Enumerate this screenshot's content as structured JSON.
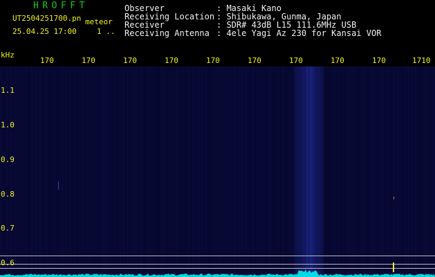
{
  "header": {
    "app_title": "HROFFT",
    "filename": "UT2504251700.pn",
    "mode": "meteor",
    "datetime": "25.04.25 17:00",
    "count": "1 .."
  },
  "station": {
    "fields": [
      {
        "label": "Observer",
        "value": ": Masaki Kano"
      },
      {
        "label": "Receiving Location",
        "value": ": Shibukawa, Gunma, Japan"
      },
      {
        "label": "Receiver",
        "value": ": SDR# 43dB L15 111.6MHz USB"
      },
      {
        "label": "Receiving Antenna",
        "value": ": 4ele Yagi Az 230 for Kansai VOR"
      }
    ]
  },
  "axes": {
    "y_unit": "kHz",
    "x_ticks": [
      "170",
      "170",
      "170",
      "170",
      "170",
      "170",
      "170",
      "170",
      "170",
      "1710"
    ],
    "y_ticks": [
      "1.1",
      "1.0",
      "0.9",
      "0.8",
      "0.7",
      "0.6"
    ]
  },
  "colors": {
    "background": "#000000",
    "plot_background": "#06072e",
    "noise": "#1a2478",
    "signal": "#2a3cc8",
    "trace": "#00ffff",
    "text": "#f2f2f2",
    "accent": "#f0f020",
    "title": "#19c919"
  }
}
